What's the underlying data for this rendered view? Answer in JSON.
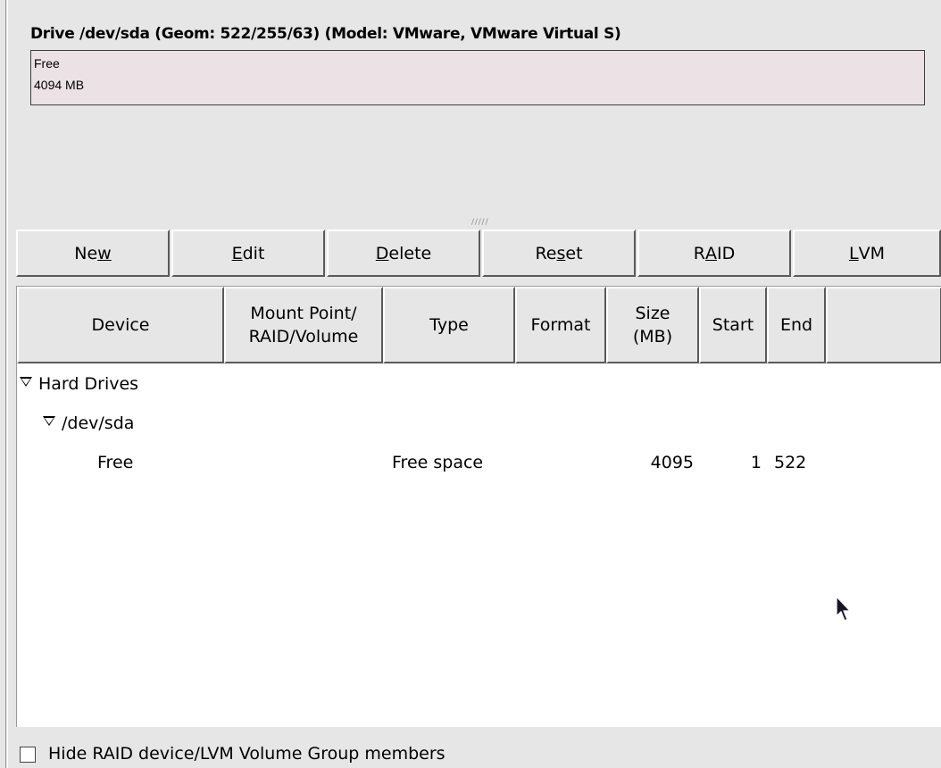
{
  "drive": {
    "title": "Drive /dev/sda (Geom: 522/255/63) (Model: VMware, VMware Virtual S)",
    "segment_label": "Free",
    "segment_size": "4094 MB"
  },
  "toolbar": {
    "buttons": [
      {
        "pre": "Ne",
        "mnemonic": "w",
        "post": ""
      },
      {
        "pre": "",
        "mnemonic": "E",
        "post": "dit"
      },
      {
        "pre": "",
        "mnemonic": "D",
        "post": "elete"
      },
      {
        "pre": "Re",
        "mnemonic": "s",
        "post": "et"
      },
      {
        "pre": "R",
        "mnemonic": "A",
        "post": "ID"
      },
      {
        "pre": "",
        "mnemonic": "L",
        "post": "VM"
      }
    ]
  },
  "table": {
    "columns": [
      "Device",
      "Mount Point/\nRAID/Volume",
      "Type",
      "Format",
      "Size\n(MB)",
      "Start",
      "End",
      ""
    ],
    "tree": {
      "group_label": "Hard Drives",
      "drive_label": "/dev/sda",
      "rows": [
        {
          "device": "Free",
          "mount": "",
          "type": "Free space",
          "format": "",
          "size": "4095",
          "start": "1",
          "end": "522"
        }
      ]
    }
  },
  "footer": {
    "hide_members_label": "Hide RAID device/LVM Volume Group members",
    "hide_members_checked": false
  },
  "icons": {
    "expander": "triangle-down-icon",
    "pointer": "mouse-pointer-icon"
  },
  "colors": {
    "window_bg": "#e6e6e6",
    "drive_segment_bg": "#ece2e6",
    "table_bg": "#ffffff"
  }
}
